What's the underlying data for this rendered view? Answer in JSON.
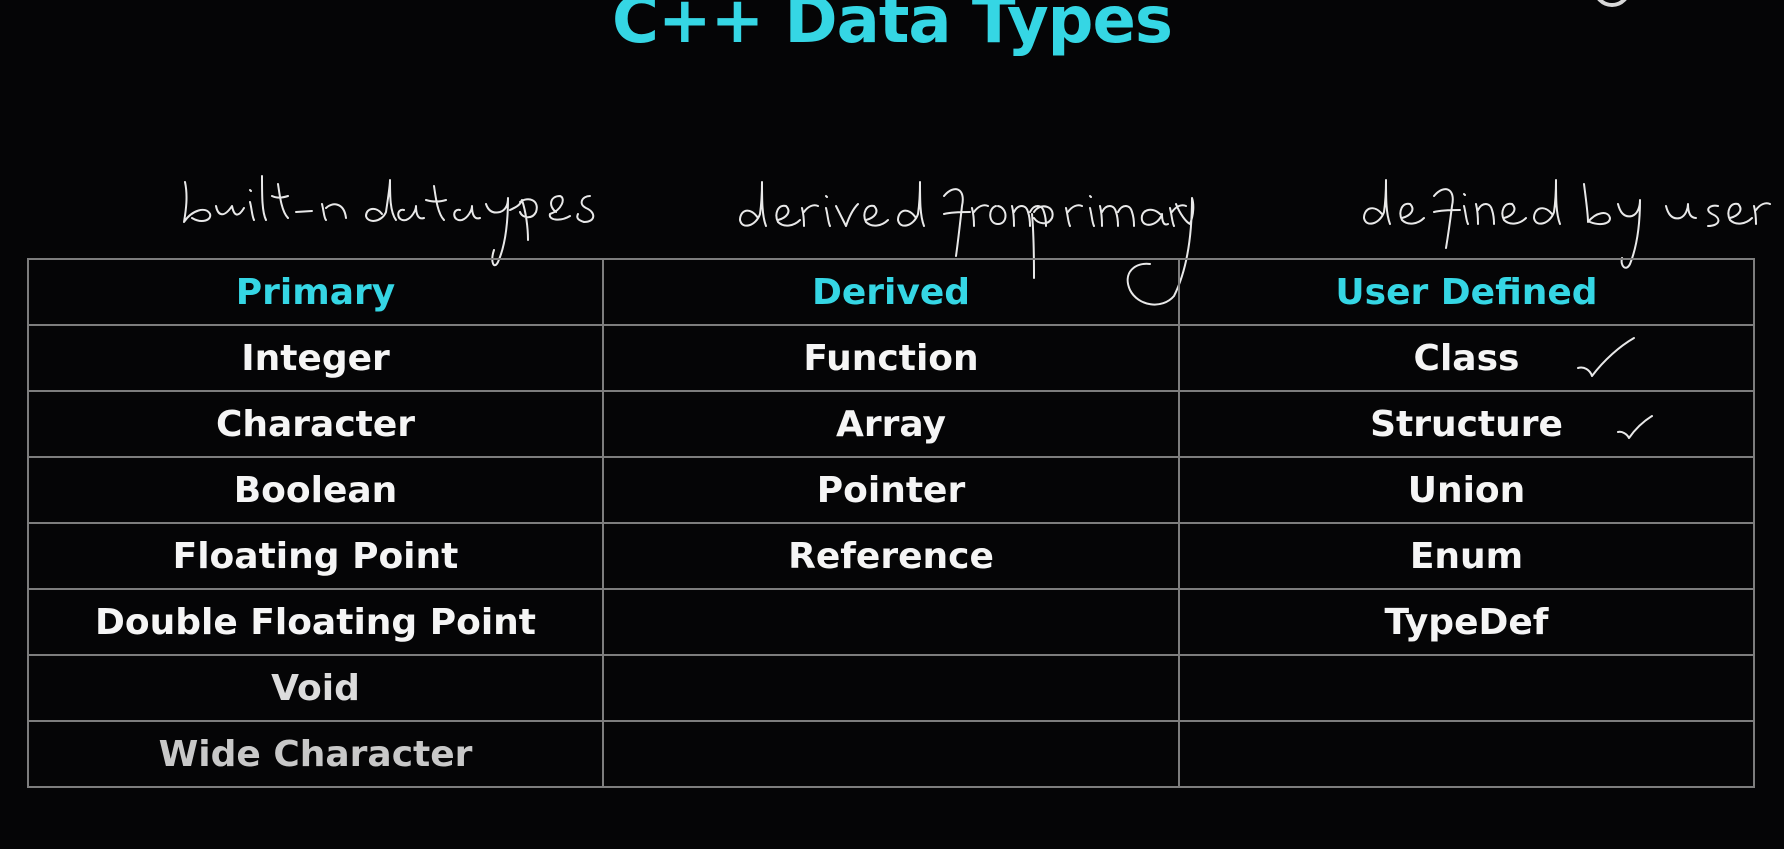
{
  "slide": {
    "title": "C++ Data Types",
    "accent_color": "#35d6e4",
    "background_color": "#050506",
    "logo": "channel-logo-mark"
  },
  "annotations": {
    "primary_note": "built-in datatypes",
    "derived_note": "derived from primary",
    "user_defined_note": "defined by user",
    "checkmarks": [
      "Class",
      "Structure"
    ]
  },
  "table": {
    "headers": [
      "Primary",
      "Derived",
      "User Defined"
    ],
    "rows": [
      [
        "Integer",
        "Function",
        "Class"
      ],
      [
        "Character",
        "Array",
        "Structure"
      ],
      [
        "Boolean",
        "Pointer",
        "Union"
      ],
      [
        "Floating Point",
        "Reference",
        "Enum"
      ],
      [
        "Double Floating Point",
        "",
        "TypeDef"
      ],
      [
        "Void",
        "",
        ""
      ],
      [
        "Wide Character",
        "",
        ""
      ]
    ]
  }
}
